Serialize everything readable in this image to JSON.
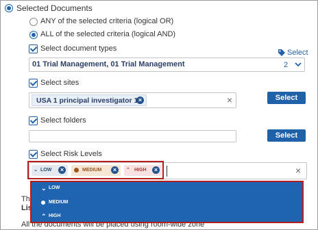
{
  "scope": {
    "selected_documents_label": "Selected Documents",
    "any_criteria_label": "ANY of the selected criteria (logical OR)",
    "all_criteria_label": "ALL of the selected criteria (logical AND)"
  },
  "document_types": {
    "label": "Select document types",
    "select_link": "Select",
    "value": "01 Trial Management, 01 Trial Management",
    "count": "2"
  },
  "sites": {
    "label": "Select sites",
    "chip": "USA 1 principal investigator 1",
    "select_button": "Select"
  },
  "folders": {
    "label": "Select folders",
    "select_button": "Select"
  },
  "risk_levels": {
    "label": "Select Risk Levels",
    "tags": [
      "LOW",
      "MEDIUM",
      "HIGH"
    ],
    "options": [
      "LOW",
      "MEDIUM",
      "HIGH"
    ]
  },
  "background_text": {
    "line1": "Th",
    "line2": "Lis",
    "line3": "All the documents will be placed using room-wide zone"
  },
  "colors": {
    "primary": "#1f62aa",
    "dropdown_bg": "#1e64b0",
    "highlight_border": "#b71c1c"
  }
}
